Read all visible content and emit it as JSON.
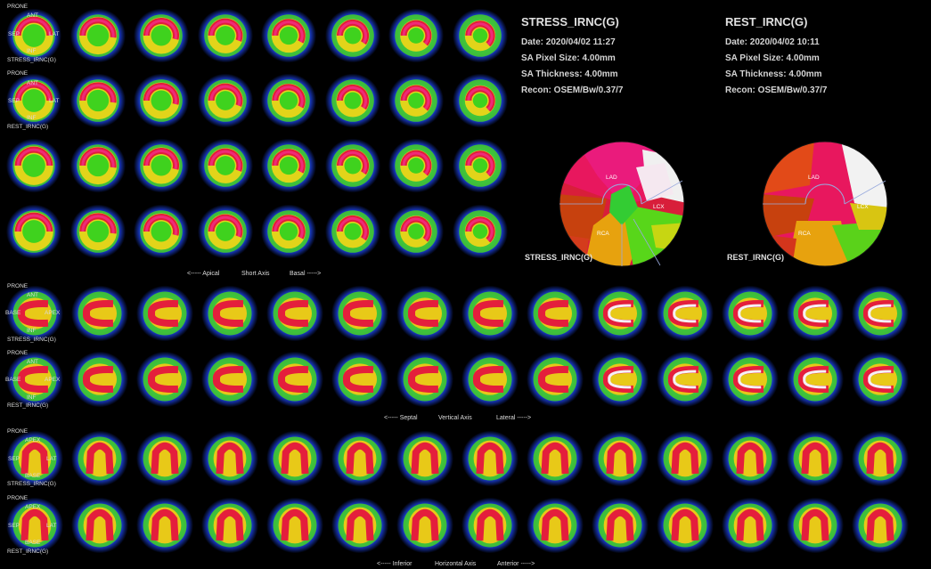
{
  "colors": {
    "background": "#000000",
    "text": "#dcdcdc"
  },
  "short_axis": {
    "stress_orientation": {
      "top": "PRONE",
      "ant": "ANT",
      "sep": "SEP",
      "lat": "LAT",
      "inf": "INF",
      "series": "STRESS_IRNC(G)"
    },
    "rest_orientation": {
      "top": "PRONE",
      "ant": "ANT",
      "sep": "SEP",
      "lat": "LAT",
      "inf": "INF",
      "series": "REST_IRNC(G)"
    },
    "axis_left": "<----- Apical",
    "axis_mid": "Short Axis",
    "axis_right": "Basal ----->"
  },
  "vertical_axis": {
    "stress_orientation": {
      "top": "PRONE",
      "ant": "ANT",
      "base": "BASE",
      "apex": "APEX",
      "inf": "INF",
      "series": "STRESS_IRNC(G)"
    },
    "rest_orientation": {
      "top": "PRONE",
      "ant": "ANT",
      "base": "BASE",
      "apex": "APEX",
      "inf": "INF",
      "series": "REST_IRNC(G)"
    },
    "axis_left": "<----- Septal",
    "axis_mid": "Vertical Axis",
    "axis_right": "Lateral ----->"
  },
  "horizontal_axis": {
    "stress_orientation": {
      "top": "PRONE",
      "apex": "APEX",
      "sep": "SEP",
      "lat": "LAT",
      "base": "BASE",
      "series": "STRESS_IRNC(G)"
    },
    "rest_orientation": {
      "top": "PRONE",
      "apex": "APEX",
      "sep": "SEP",
      "lat": "LAT",
      "base": "BASE",
      "series": "REST_IRNC(G)"
    },
    "axis_left": "<----- Inferior",
    "axis_mid": "Horizontal Axis",
    "axis_right": "Anterior ----->"
  },
  "stress_info": {
    "title": "STRESS_IRNC(G)",
    "date": "Date: 2020/04/02 11:27",
    "pixel": "SA Pixel Size: 4.00mm",
    "thickness": "SA Thickness: 4.00mm",
    "recon": "Recon: OSEM/Bw/0.37/7"
  },
  "rest_info": {
    "title": "REST_IRNC(G)",
    "date": "Date: 2020/04/02 10:11",
    "pixel": "SA Pixel Size: 4.00mm",
    "thickness": "SA Thickness: 4.00mm",
    "recon": "Recon: OSEM/Bw/0.37/7"
  },
  "polar_stress": {
    "caption": "STRESS_IRNC(G)",
    "lad": "LAD",
    "lcx": "LCX",
    "rca": "RCA"
  },
  "polar_rest": {
    "caption": "REST_IRNC(G)",
    "lad": "LAD",
    "lcx": "LCX",
    "rca": "RCA"
  }
}
